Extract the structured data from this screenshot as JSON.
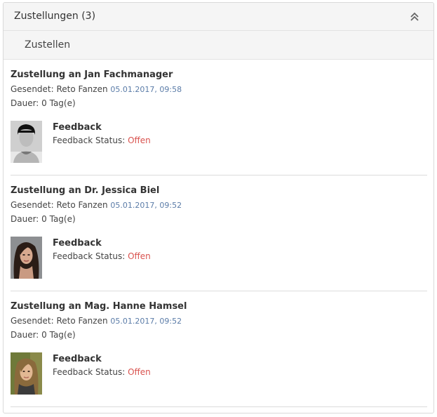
{
  "panel": {
    "title": "Zustellungen (3)",
    "action": "Zustellen"
  },
  "entries": [
    {
      "title": "Zustellung an Jan Fachmanager",
      "sent_label": "Gesendet: Reto Fanzen",
      "sent_date": "05.01.2017, 09:58",
      "duration": "Dauer: 0 Tag(e)",
      "feedback_title": "Feedback",
      "feedback_status_label": "Feedback Status:",
      "feedback_status_value": "Offen"
    },
    {
      "title": "Zustellung an Dr. Jessica Biel",
      "sent_label": "Gesendet: Reto Fanzen",
      "sent_date": "05.01.2017, 09:52",
      "duration": "Dauer: 0 Tag(e)",
      "feedback_title": "Feedback",
      "feedback_status_label": "Feedback Status:",
      "feedback_status_value": "Offen"
    },
    {
      "title": "Zustellung an Mag. Hanne Hamsel",
      "sent_label": "Gesendet: Reto Fanzen",
      "sent_date": "05.01.2017, 09:52",
      "duration": "Dauer: 0 Tag(e)",
      "feedback_title": "Feedback",
      "feedback_status_label": "Feedback Status:",
      "feedback_status_value": "Offen"
    }
  ],
  "colors": {
    "status_open": "#d9534f",
    "date": "#5b7ca8"
  }
}
